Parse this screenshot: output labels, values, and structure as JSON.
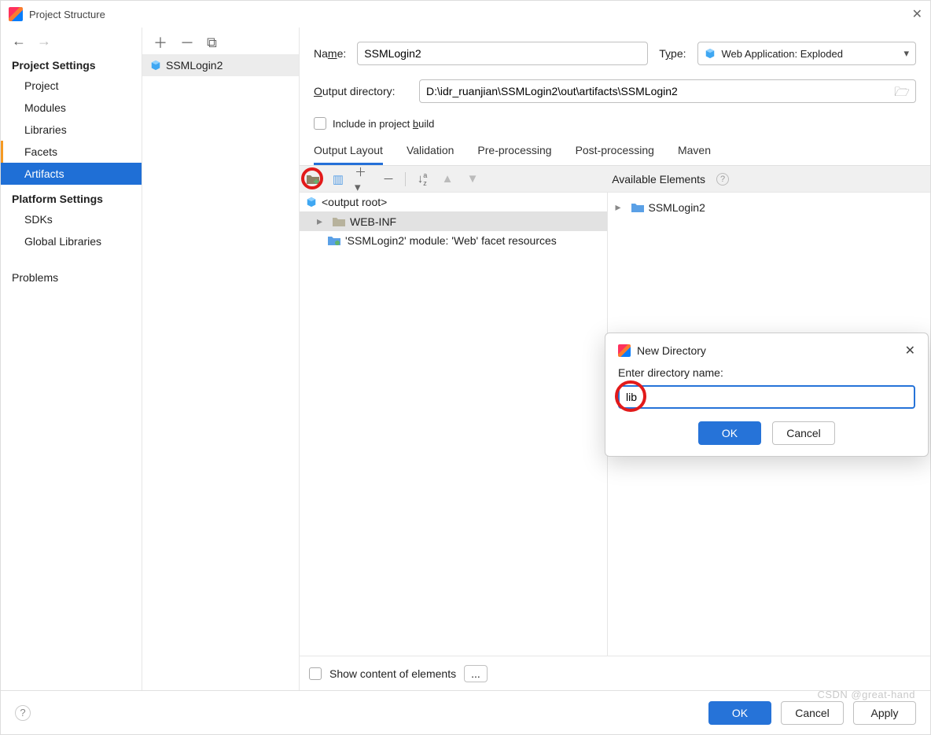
{
  "window": {
    "title": "Project Structure"
  },
  "sidebar": {
    "sectionA": "Project Settings",
    "items": [
      "Project",
      "Modules",
      "Libraries",
      "Facets",
      "Artifacts"
    ],
    "sectionB": "Platform Settings",
    "itemsB": [
      "SDKs",
      "Global Libraries"
    ],
    "problems": "Problems"
  },
  "artifact_list": {
    "name": "SSMLogin2"
  },
  "form": {
    "name_label": "Name:",
    "name_value": "SSMLogin2",
    "type_label": "Type:",
    "type_value": "Web Application: Exploded",
    "output_label": "Output directory:",
    "output_value": "D:\\idr_ruanjian\\SSMLogin2\\out\\artifacts\\SSMLogin2",
    "include_label": "Include in project build"
  },
  "tabs": [
    "Output Layout",
    "Validation",
    "Pre-processing",
    "Post-processing",
    "Maven"
  ],
  "toolbar": {
    "avail_label": "Available Elements"
  },
  "tree": {
    "root": "<output root>",
    "webinf": "WEB-INF",
    "facet": "'SSMLogin2' module: 'Web' facet resources",
    "right_item": "SSMLogin2"
  },
  "bottom": {
    "show_label": "Show content of elements",
    "ellipsis": "..."
  },
  "footer": {
    "ok": "OK",
    "cancel": "Cancel",
    "apply": "Apply"
  },
  "modal": {
    "title": "New Directory",
    "label": "Enter directory name:",
    "value": "lib",
    "ok": "OK",
    "cancel": "Cancel"
  },
  "watermark": "CSDN @great-hand"
}
